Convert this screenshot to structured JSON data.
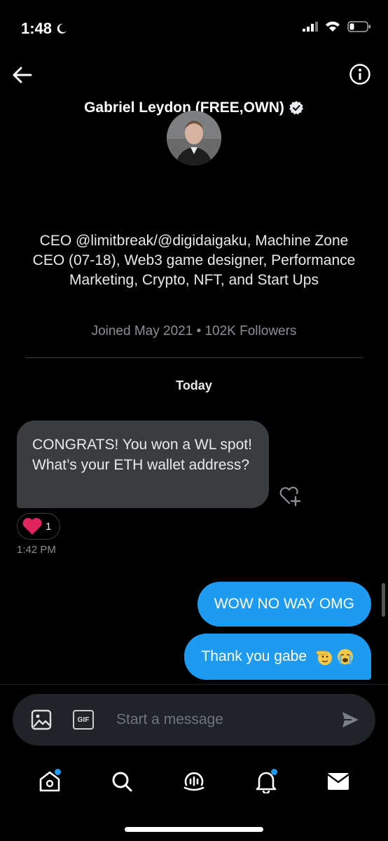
{
  "status_bar": {
    "time": "1:48"
  },
  "header": {
    "title": "Gabriel Leydon (FREE,OWN)"
  },
  "profile": {
    "bio": "CEO @limitbreak/@digidaigaku, Machine Zone CEO (07-18), Web3 game designer, Performance Marketing, Crypto, NFT, and Start Ups",
    "joined": "Joined May 2021 • 102K Followers"
  },
  "conversation": {
    "date_label": "Today",
    "incoming": {
      "text": "CONGRATS! You won a WL spot! What’s your ETH wallet address?",
      "reaction_count": "1",
      "time": "1:42 PM"
    },
    "outgoing": [
      {
        "text": "WOW NO WAY OMG"
      },
      {
        "text": "Thank you gabe"
      }
    ]
  },
  "composer": {
    "placeholder": "Start a message",
    "gif_label": "GIF"
  },
  "tabs": [
    "home",
    "search",
    "spaces",
    "notifications",
    "messages"
  ],
  "colors": {
    "accent": "#1d9bf0",
    "bubble_incoming": "#3a3c3f",
    "background": "#000000"
  }
}
